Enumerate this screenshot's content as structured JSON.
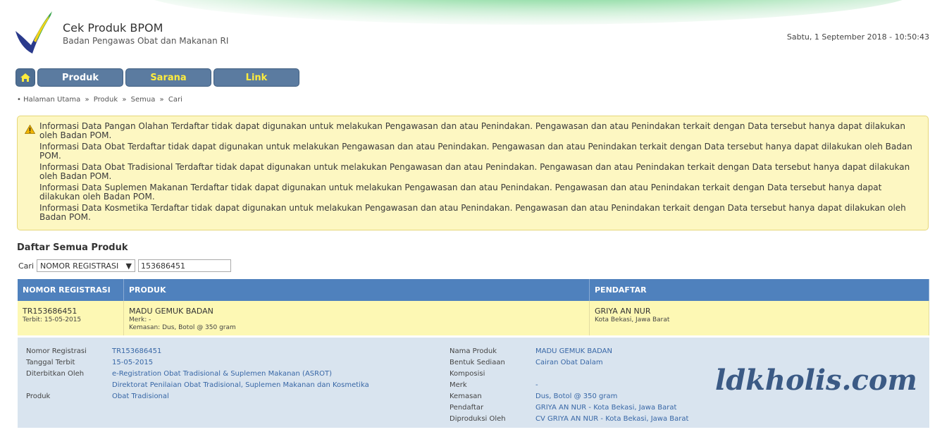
{
  "header": {
    "title": "Cek Produk BPOM",
    "subtitle": "Badan Pengawas Obat dan Makanan RI",
    "datetime": "Sabtu, 1 September 2018 - 10:50:43"
  },
  "nav": {
    "home_icon": "home-icon",
    "items": [
      {
        "label": "Produk"
      },
      {
        "label": "Sarana"
      },
      {
        "label": "Link"
      }
    ]
  },
  "breadcrumb": {
    "items": [
      "Halaman Utama",
      "Produk",
      "Semua",
      "Cari"
    ],
    "separator": "»"
  },
  "warning": {
    "icon": "warning-icon",
    "lines": [
      "Informasi Data Pangan Olahan Terdaftar tidak dapat digunakan untuk melakukan Pengawasan dan atau Penindakan. Pengawasan dan atau Penindakan terkait dengan Data tersebut hanya dapat dilakukan oleh Badan POM.",
      "Informasi Data Obat Terdaftar tidak dapat digunakan untuk melakukan Pengawasan dan atau Penindakan. Pengawasan dan atau Penindakan terkait dengan Data tersebut hanya dapat dilakukan oleh Badan POM.",
      "Informasi Data Obat Tradisional Terdaftar tidak dapat digunakan untuk melakukan Pengawasan dan atau Penindakan. Pengawasan dan atau Penindakan terkait dengan Data tersebut hanya dapat dilakukan oleh Badan POM.",
      "Informasi Data Suplemen Makanan Terdaftar tidak dapat digunakan untuk melakukan Pengawasan dan atau Penindakan. Pengawasan dan atau Penindakan terkait dengan Data tersebut hanya dapat dilakukan oleh Badan POM.",
      "Informasi Data Kosmetika Terdaftar tidak dapat digunakan untuk melakukan Pengawasan dan atau Penindakan. Pengawasan dan atau Penindakan terkait dengan Data tersebut hanya dapat dilakukan oleh Badan POM."
    ]
  },
  "list": {
    "title": "Daftar Semua Produk",
    "search_label": "Cari",
    "search_field": "NOMOR REGISTRASI",
    "search_value": "153686451",
    "columns": [
      "NOMOR REGISTRASI",
      "PRODUK",
      "PENDAFTAR"
    ],
    "row": {
      "nomor": "TR153686451",
      "terbit": "Terbit: 15-05-2015",
      "produk": "MADU GEMUK BADAN",
      "merk": "Merk: -",
      "kemasan": "Kemasan: Dus, Botol @ 350 gram",
      "pendaftar": "GRIYA AN NUR",
      "lokasi": "Kota Bekasi, Jawa Barat"
    }
  },
  "detail": {
    "left": [
      {
        "label": "Nomor Registrasi",
        "value": "TR153686451"
      },
      {
        "label": "Tanggal Terbit",
        "value": "15-05-2015"
      },
      {
        "label": "Diterbitkan Oleh",
        "value": "e-Registration Obat Tradisional & Suplemen Makanan (ASROT)"
      },
      {
        "label": "",
        "value": "Direktorat Penilaian Obat Tradisional, Suplemen Makanan dan Kosmetika"
      },
      {
        "label": "Produk",
        "value": "Obat Tradisional"
      }
    ],
    "right": [
      {
        "label": "Nama Produk",
        "value": "MADU GEMUK BADAN"
      },
      {
        "label": "Bentuk Sediaan",
        "value": "Cairan Obat Dalam"
      },
      {
        "label": "Komposisi",
        "value": ""
      },
      {
        "label": "Merk",
        "value": "-"
      },
      {
        "label": "Kemasan",
        "value": "Dus, Botol @ 350 gram"
      },
      {
        "label": "Pendaftar",
        "value": "GRIYA AN NUR - Kota Bekasi, Jawa Barat"
      },
      {
        "label": "Diproduksi Oleh",
        "value": "CV GRIYA AN NUR - Kota Bekasi, Jawa Barat"
      }
    ],
    "watermark": "ldkholis.com"
  }
}
